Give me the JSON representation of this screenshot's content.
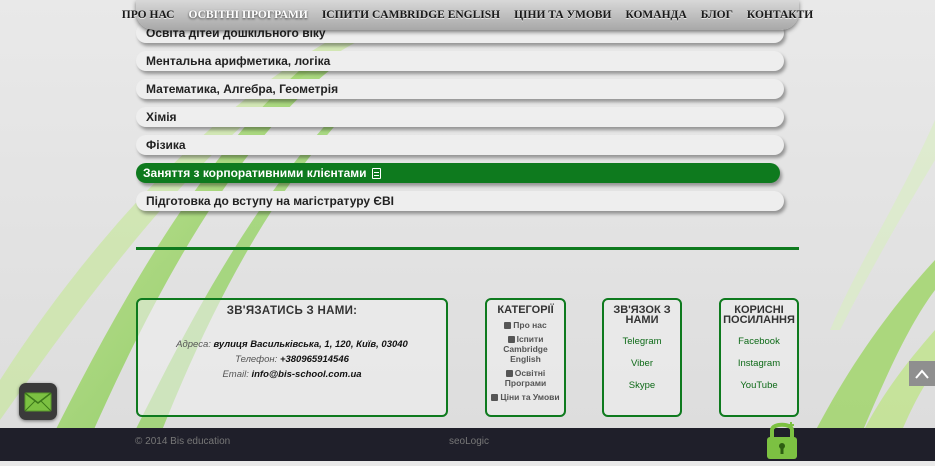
{
  "nav": {
    "items": [
      {
        "label": "ПРО НАС",
        "active": false
      },
      {
        "label": "ОСВІТНІ ПРОГРАМИ",
        "active": true
      },
      {
        "label": "ІСПИТИ CAMBRIDGE ENGLISH",
        "active": false
      },
      {
        "label": "ЦІНИ ТА УМОВИ",
        "active": false
      },
      {
        "label": "КОМАНДА",
        "active": false
      },
      {
        "label": "БЛОГ",
        "active": false
      },
      {
        "label": "КОНТАКТИ",
        "active": false
      }
    ]
  },
  "programs": {
    "items": [
      {
        "label": "Освіта дітей дошкільного віку"
      },
      {
        "label": "Ментальна арифметика, логіка"
      },
      {
        "label": "Математика, Алгебра, Геометрія"
      },
      {
        "label": "Хімія"
      },
      {
        "label": "Фізика"
      },
      {
        "label": "Заняття з корпоративними клієнтами"
      },
      {
        "label": "Підготовка до вступу на магістратуру ЄВІ"
      }
    ],
    "active_index": 5
  },
  "contact": {
    "title": "ЗВ'ЯЗАТИСЬ З НАМИ:",
    "address_label": "Адреса:",
    "address_value": "вулиця Васильківська, 1, 120, Київ, 03040",
    "phone_label": "Телефон:",
    "phone_value": "+380965914546",
    "email_label": "Email:",
    "email_value": "info@bis-school.com.ua"
  },
  "categories": {
    "title": "КАТЕГОРІЇ",
    "items": [
      {
        "label": "Про нас",
        "icon": "cube-icon"
      },
      {
        "label": "Іспити Cambridge English",
        "icon": "document-icon"
      },
      {
        "label": "Освітні Програми",
        "icon": "book-icon"
      },
      {
        "label": "Ціни та Умови",
        "icon": "money-icon"
      }
    ]
  },
  "social": {
    "title": "ЗВ'ЯЗОК З НАМИ",
    "items": [
      "Telegram",
      "Viber",
      "Skype"
    ]
  },
  "useful": {
    "title": "КОРИСНІ ПОСИЛАННЯ",
    "items": [
      "Facebook",
      "Instagram",
      "YouTube"
    ]
  },
  "footer": {
    "copyright": "© 2014 Bis education",
    "credit": "seoLogic"
  },
  "colors": {
    "accent": "#0e7a1e",
    "bottom_bar": "#1f1f2a"
  }
}
